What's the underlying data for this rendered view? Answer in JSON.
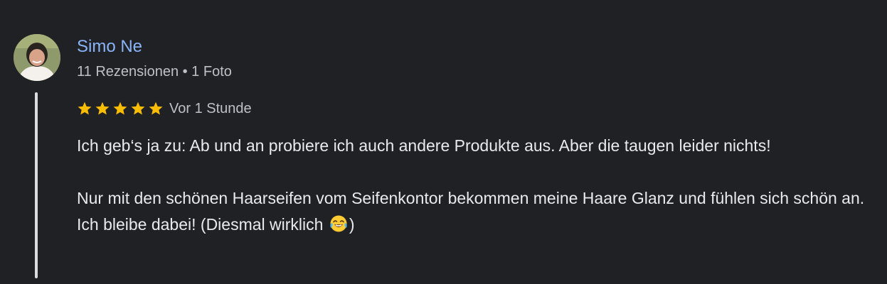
{
  "review": {
    "author": {
      "name": "Simo Ne",
      "meta": "11 Rezensionen • 1 Foto",
      "avatar_icon": "profile-photo"
    },
    "rating": {
      "stars": 5,
      "max": 5,
      "star_icon": "star-icon",
      "color": "#fbbc04"
    },
    "time": "Vor 1 Stunde",
    "text": {
      "paragraph1": "Ich geb‘s ja zu: Ab und an probiere ich auch andere Produkte aus. Aber die taugen leider nichts!",
      "paragraph2_main": "Nur mit den schönen Haarseifen vom Seifenkontor bekommen meine Haare Glanz und fühlen sich schön an. Ich bleibe dabei! (Diesmal wirklich",
      "paragraph2_emoji_icon": "tears-of-joy-emoji-icon",
      "paragraph2_end": ")"
    }
  },
  "colors": {
    "background": "#202124",
    "link": "#8ab4f8",
    "text": "#e8eaed",
    "secondary_text": "#bdc1c6",
    "thread_line": "#dadce0"
  }
}
